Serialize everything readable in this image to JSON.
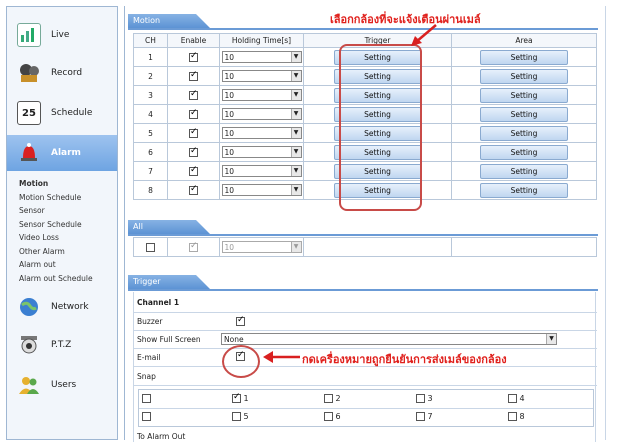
{
  "sidebar": {
    "items": [
      {
        "label": "Live",
        "icon": "live-icon"
      },
      {
        "label": "Record",
        "icon": "record-icon"
      },
      {
        "label": "Schedule",
        "icon": "schedule-icon",
        "badge": "25"
      },
      {
        "label": "Alarm",
        "icon": "alarm-icon"
      },
      {
        "label": "Network",
        "icon": "network-icon"
      },
      {
        "label": "P.T.Z",
        "icon": "ptz-icon"
      },
      {
        "label": "Users",
        "icon": "users-icon"
      }
    ],
    "sub_items": [
      "Motion",
      "Motion Schedule",
      "Sensor",
      "Sensor Schedule",
      "Video Loss",
      "Other Alarm",
      "Alarm out",
      "Alarm out Schedule"
    ]
  },
  "motion": {
    "tab": "Motion",
    "headers": {
      "ch": "CH",
      "enable": "Enable",
      "holding": "Holding Time[s]",
      "trigger": "Trigger",
      "area": "Area"
    },
    "rows": [
      {
        "ch": "1",
        "enabled": true,
        "holding": "10",
        "trigger": "Setting",
        "area": "Setting"
      },
      {
        "ch": "2",
        "enabled": true,
        "holding": "10",
        "trigger": "Setting",
        "area": "Setting"
      },
      {
        "ch": "3",
        "enabled": true,
        "holding": "10",
        "trigger": "Setting",
        "area": "Setting"
      },
      {
        "ch": "4",
        "enabled": true,
        "holding": "10",
        "trigger": "Setting",
        "area": "Setting"
      },
      {
        "ch": "5",
        "enabled": true,
        "holding": "10",
        "trigger": "Setting",
        "area": "Setting"
      },
      {
        "ch": "6",
        "enabled": true,
        "holding": "10",
        "trigger": "Setting",
        "area": "Setting"
      },
      {
        "ch": "7",
        "enabled": true,
        "holding": "10",
        "trigger": "Setting",
        "area": "Setting"
      },
      {
        "ch": "8",
        "enabled": true,
        "holding": "10",
        "trigger": "Setting",
        "area": "Setting"
      }
    ]
  },
  "all": {
    "tab": "All",
    "holding": "10"
  },
  "trigger": {
    "tab": "Trigger",
    "channel": "Channel 1",
    "buzzer": "Buzzer",
    "show_full_screen": "Show Full Screen",
    "show_full_screen_value": "None",
    "email": "E-mail",
    "snap": "Snap",
    "snap_channels": [
      "",
      "1",
      "2",
      "3",
      "4",
      "",
      "5",
      "6",
      "7",
      "8"
    ],
    "footer_partial": "To Alarm Out"
  },
  "annotations": {
    "top": "เลือกกล้องที่จะแจ้งเตือนผ่านเมล์",
    "email": "กดเครื่องหมายถูกยืนยันการส่งเมล์ของกล้อง"
  }
}
